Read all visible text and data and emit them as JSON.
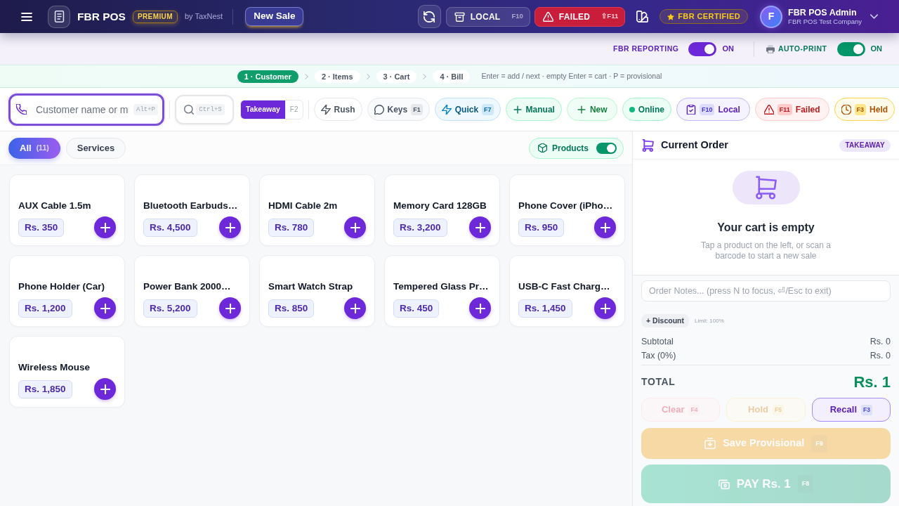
{
  "header": {
    "app_name": "FBR POS",
    "tier_badge": "PREMIUM",
    "vendor": "by TaxNest",
    "new_sale_button": "New Sale",
    "queue_buttons": [
      {
        "kind": "local",
        "label": "LOCAL",
        "shortcut": "F10"
      },
      {
        "kind": "failed",
        "label": "FAILED",
        "shortcut": "⇧F11"
      }
    ],
    "certified_badge": "FBR CERTIFIED",
    "user": {
      "initial": "F",
      "name": "FBR POS Admin",
      "company": "FBR POS Test Company"
    }
  },
  "settings_bar": {
    "toggles": [
      {
        "kind": "reporting",
        "label": "FBR REPORTING",
        "on": true,
        "state_text": "ON"
      },
      {
        "kind": "print",
        "label": "AUTO-PRINT",
        "on": true,
        "state_text": "ON"
      }
    ]
  },
  "steps": {
    "items": [
      {
        "label": "1 · Customer",
        "selected": true
      },
      {
        "label": "2 · Items",
        "selected": false
      },
      {
        "label": "3 · Cart",
        "selected": false
      },
      {
        "label": "4 · Bill",
        "selected": false
      }
    ],
    "hint": "Enter = add / next · empty Enter = cart · P = provisional"
  },
  "toolbar": {
    "customer_field": {
      "placeholder": "Customer name or m",
      "shortcut": "Alt+P"
    },
    "search_shortcut": "Ctrl+S",
    "order_type": {
      "label": "Takeaway",
      "shortcut": "F2",
      "selected": true
    },
    "buttons": [
      {
        "kind": "rush",
        "label": "Rush"
      },
      {
        "kind": "keys",
        "label": "Keys",
        "shortcut": "F1"
      },
      {
        "kind": "quick",
        "label": "Quick",
        "shortcut": "F7"
      },
      {
        "kind": "manual",
        "label": "Manual"
      },
      {
        "kind": "new",
        "label": "New"
      },
      {
        "kind": "online",
        "label": "Online"
      },
      {
        "kind": "local",
        "label": "Local",
        "shortcut": "F10"
      },
      {
        "kind": "failed",
        "label": "Failed",
        "shortcut": "F11"
      },
      {
        "kind": "held",
        "label": "Held",
        "shortcut": "F3"
      }
    ]
  },
  "catalog": {
    "tabs": [
      {
        "label": "All",
        "count": "(11)",
        "selected": true
      },
      {
        "label": "Services",
        "selected": false
      }
    ],
    "products_toggle": {
      "label": "Products",
      "on": true
    },
    "products": [
      {
        "name": "AUX Cable 1.5m",
        "price": "Rs. 350"
      },
      {
        "name": "Bluetooth Earbuds…",
        "price": "Rs. 4,500"
      },
      {
        "name": "HDMI Cable 2m",
        "price": "Rs. 780"
      },
      {
        "name": "Memory Card 128GB",
        "price": "Rs. 3,200"
      },
      {
        "name": "Phone Cover (iPho…",
        "price": "Rs. 950"
      },
      {
        "name": "Phone Holder (Car)",
        "price": "Rs. 1,200"
      },
      {
        "name": "Power Bank 2000…",
        "price": "Rs. 5,200"
      },
      {
        "name": "Smart Watch Strap",
        "price": "Rs. 850"
      },
      {
        "name": "Tempered Glass Pr…",
        "price": "Rs. 450"
      },
      {
        "name": "USB-C Fast Charg…",
        "price": "Rs. 1,450"
      },
      {
        "name": "Wireless Mouse",
        "price": "Rs. 1,850"
      }
    ]
  },
  "order": {
    "title": "Current Order",
    "type_badge": "TAKEAWAY",
    "empty_title": "Your cart is empty",
    "empty_text": "Tap a product on the left, or scan a barcode to start a new sale",
    "notes_placeholder": "Order Notes... (press N to focus, ⏎/Esc to exit)",
    "discount_button": "+ Discount",
    "discount_limit": "Limit: 100%",
    "summary": [
      {
        "label": "Subtotal",
        "value": "Rs. 0"
      },
      {
        "label": "Tax (0%)",
        "value": "Rs. 0"
      }
    ],
    "total_label": "TOTAL",
    "total_value": "Rs. 1",
    "actions": [
      {
        "kind": "clear",
        "label": "Clear",
        "shortcut": "F4",
        "disabled": true
      },
      {
        "kind": "hold",
        "label": "Hold",
        "shortcut": "F5",
        "disabled": true
      },
      {
        "kind": "recall",
        "label": "Recall",
        "shortcut": "F3",
        "disabled": false
      }
    ],
    "save_button": {
      "label": "Save Provisional",
      "shortcut": "F9",
      "disabled": true
    },
    "pay_button": {
      "label": "PAY Rs. 1",
      "shortcut": "F8",
      "disabled": true
    }
  }
}
